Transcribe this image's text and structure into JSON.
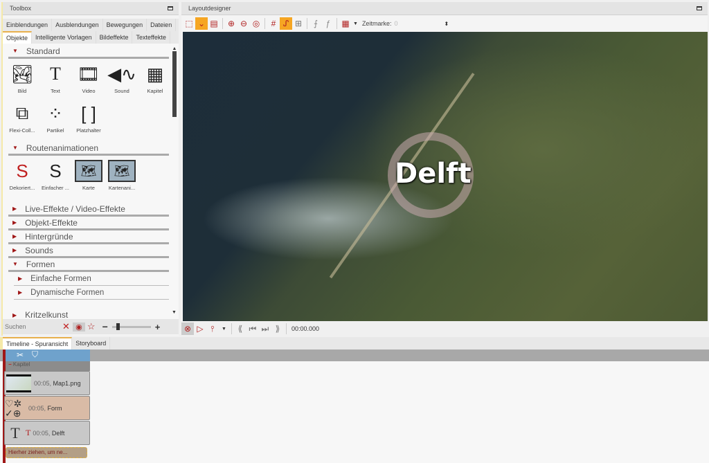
{
  "toolbox": {
    "title": "Toolbox",
    "tabs_row1": [
      "Einblendungen",
      "Ausblendungen",
      "Bewegungen",
      "Dateien"
    ],
    "tabs_row2": [
      "Objekte",
      "Intelligente Vorlagen",
      "Bildeffekte",
      "Texteffekte"
    ],
    "active_tab": "Objekte",
    "standard": {
      "label": "Standard",
      "items": [
        {
          "label": "Bild",
          "icon": "image-icon"
        },
        {
          "label": "Text",
          "icon": "text-icon"
        },
        {
          "label": "Video",
          "icon": "video-icon"
        },
        {
          "label": "Sound",
          "icon": "sound-icon"
        },
        {
          "label": "Kapitel",
          "icon": "chapter-icon"
        },
        {
          "label": "Flexi-Coll...",
          "icon": "collage-icon"
        },
        {
          "label": "Partikel",
          "icon": "particle-icon"
        },
        {
          "label": "Platzhalter",
          "icon": "placeholder-icon"
        }
      ]
    },
    "route": {
      "label": "Routenanimationen",
      "items": [
        {
          "label": "Dekoriert...",
          "icon": "decorated-route-icon"
        },
        {
          "label": "Einfacher ...",
          "icon": "simple-route-icon"
        },
        {
          "label": "Karte",
          "icon": "map-icon"
        },
        {
          "label": "Kartenani...",
          "icon": "map-animation-icon"
        }
      ]
    },
    "sections": [
      "Live-Effekte / Video-Effekte",
      "Objekt-Effekte",
      "Hintergründe",
      "Sounds"
    ],
    "formen": {
      "label": "Formen",
      "subs": [
        "Einfache Formen",
        "Dynamische Formen"
      ]
    },
    "last_section": "Kritzelkunst",
    "search_placeholder": "Suchen"
  },
  "layout": {
    "title": "Layoutdesigner",
    "zeitmarke_label": "Zeitmarke:",
    "zeitmarke_value": "0",
    "map_label": "Delft",
    "time": "00:00.000"
  },
  "timeline": {
    "tabs": [
      "Timeline - Spuransicht",
      "Storyboard"
    ],
    "chapter": "Kapitel",
    "clips": [
      {
        "duration": "00:05,",
        "name": "Map1.png"
      },
      {
        "duration": "00:05,",
        "name": "Form"
      },
      {
        "duration": "00:05,",
        "name": "Delft"
      }
    ],
    "drop_hint": "Hierher ziehen, um ne..."
  },
  "colors": {
    "accent": "#f6a623",
    "red": "#b02020",
    "form_clip": "#d9bba6",
    "clip": "#c8c8c8"
  }
}
